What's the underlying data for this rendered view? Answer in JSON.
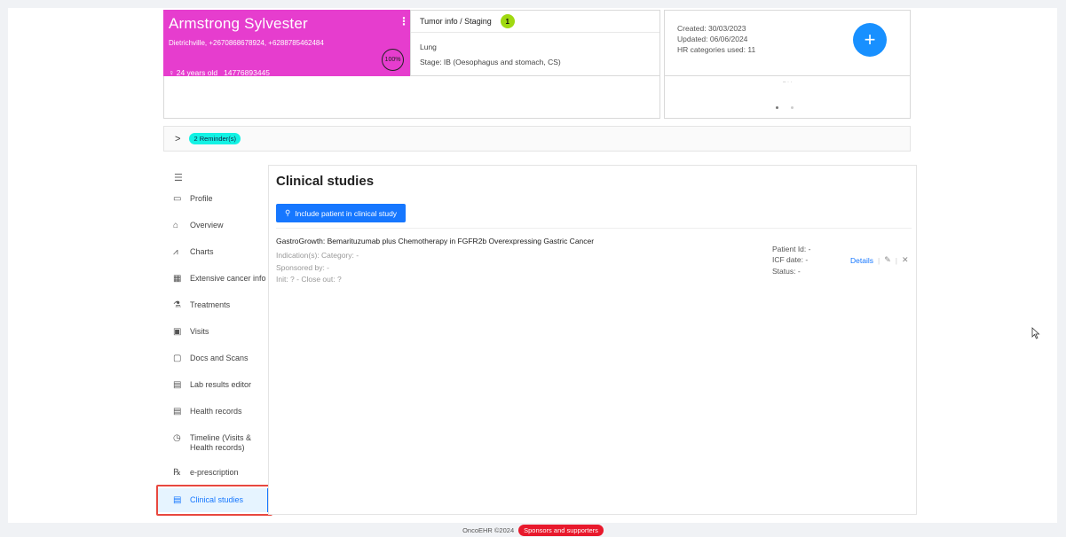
{
  "patient": {
    "name": "Armstrong Sylvester",
    "contacts": "Dietrichville, +2670868678924, +6288785462484",
    "age": "♀ 24 years old",
    "id_number": "14776893445",
    "completeness": "100%",
    "card_color": "#e63dce"
  },
  "tumor": {
    "header": "Tumor info / Staging",
    "count": "1",
    "site": "Lung",
    "stage": "Stage: IB (Oesophagus and stomach, CS)"
  },
  "record_info": {
    "created": "Created: 30/03/2023",
    "updated": "Updated: 06/06/2024",
    "hr_categories": "HR categories used: 11",
    "add_label": "+"
  },
  "reminders": {
    "chevron": ">",
    "label": "2 Reminder(s)"
  },
  "sidebar": {
    "collapse_icon": "☰",
    "items": [
      {
        "label": "Profile",
        "icon": "▭"
      },
      {
        "label": "Overview",
        "icon": "⌂"
      },
      {
        "label": "Charts",
        "icon": "⩘"
      },
      {
        "label": "Extensive cancer info",
        "icon": "▦"
      },
      {
        "label": "Treatments",
        "icon": "⚗"
      },
      {
        "label": "Visits",
        "icon": "▣"
      },
      {
        "label": "Docs and Scans",
        "icon": "▢"
      },
      {
        "label": "Lab results editor",
        "icon": "▤"
      },
      {
        "label": "Health records",
        "icon": "▤"
      },
      {
        "label": "Timeline (Visits & Health records)",
        "icon": "◷"
      },
      {
        "label": "e-prescription",
        "icon": "℞"
      },
      {
        "label": "Clinical studies",
        "icon": "▤"
      }
    ],
    "active_index": 11
  },
  "main": {
    "title": "Clinical studies",
    "include_button": "Include patient in clinical study",
    "study": {
      "title": "GastroGrowth: Bemarituzumab plus Chemotherapy in FGFR2b Overexpressing Gastric Cancer",
      "indication": "Indication(s):   Category: -",
      "sponsored_by": "Sponsored by: -",
      "init": "Init: ? - Close out: ?",
      "patient_id": "Patient Id: -",
      "icf_date": "ICF date: -",
      "status": "Status: -",
      "details_label": "Details",
      "edit_icon": "✎",
      "delete_icon": "✕"
    }
  },
  "footer": {
    "copyright": "OncoEHR ©2024",
    "sponsors_label": "Sponsors and supporters"
  },
  "colors": {
    "accent": "#1677ff",
    "reminder": "#13f2e4",
    "sponsors": "#e8192c",
    "badge": "#a0d911"
  }
}
